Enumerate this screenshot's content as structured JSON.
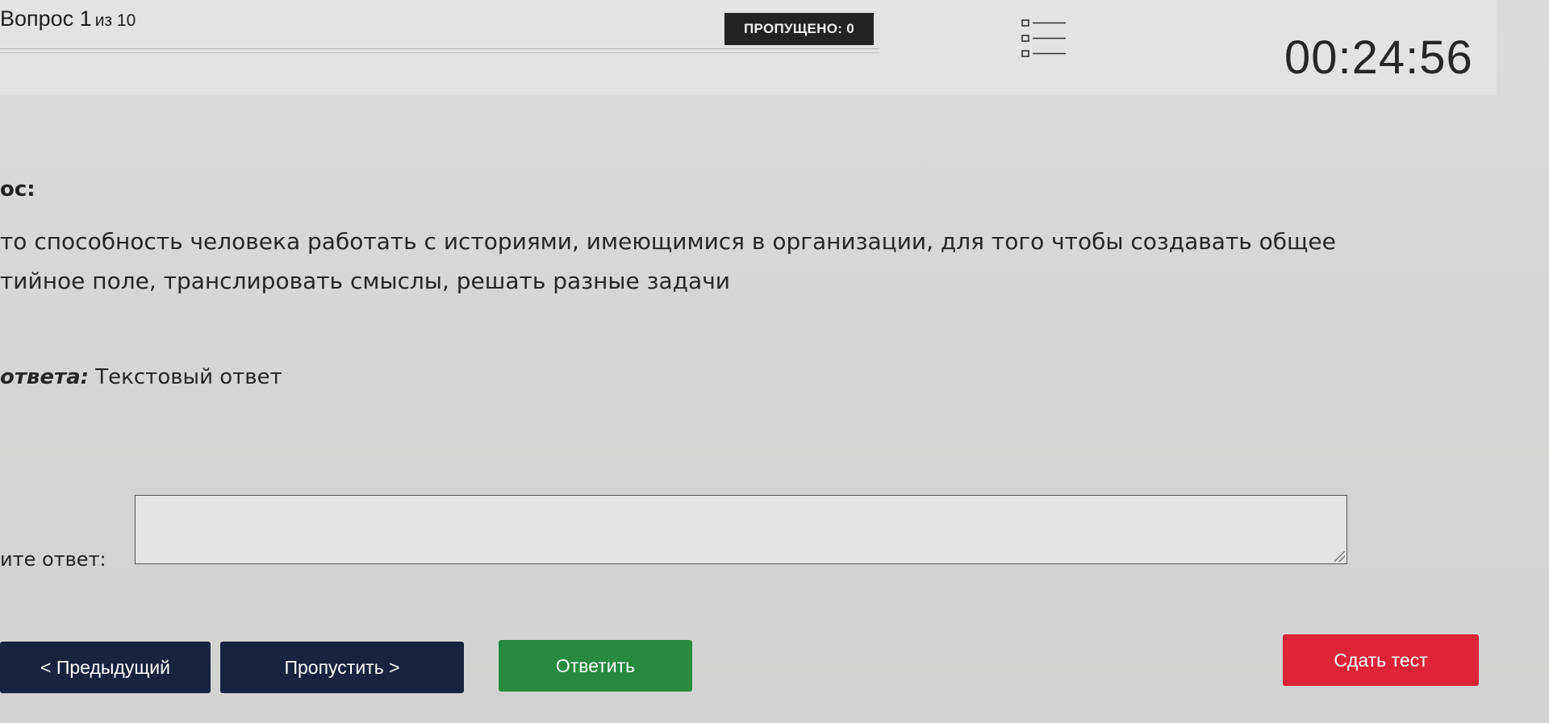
{
  "header": {
    "question_prefix": "Вопрос 1",
    "question_of": "из 10",
    "skipped_label": "ПРОПУЩЕНО: 0",
    "list_icon": "question-list-icon",
    "timer": "00:24:56"
  },
  "question": {
    "label": "ос:",
    "line1": "то способность человека работать с историями, имеющимися в организации, для того чтобы создавать общее",
    "line2": "тийное поле, транслировать смыслы, решать разные задачи"
  },
  "answer_type": {
    "label": "ответа:",
    "value": "Текстовый ответ"
  },
  "answer_input": {
    "label": "ите ответ:",
    "value": ""
  },
  "buttons": {
    "prev": "< Предыдущий",
    "skip": "Пропустить >",
    "answer": "Ответить",
    "submit": "Сдать тест"
  },
  "colors": {
    "nav_button": "#17233f",
    "answer_button": "#278a3f",
    "submit_button": "#de2437",
    "badge": "#232323"
  }
}
